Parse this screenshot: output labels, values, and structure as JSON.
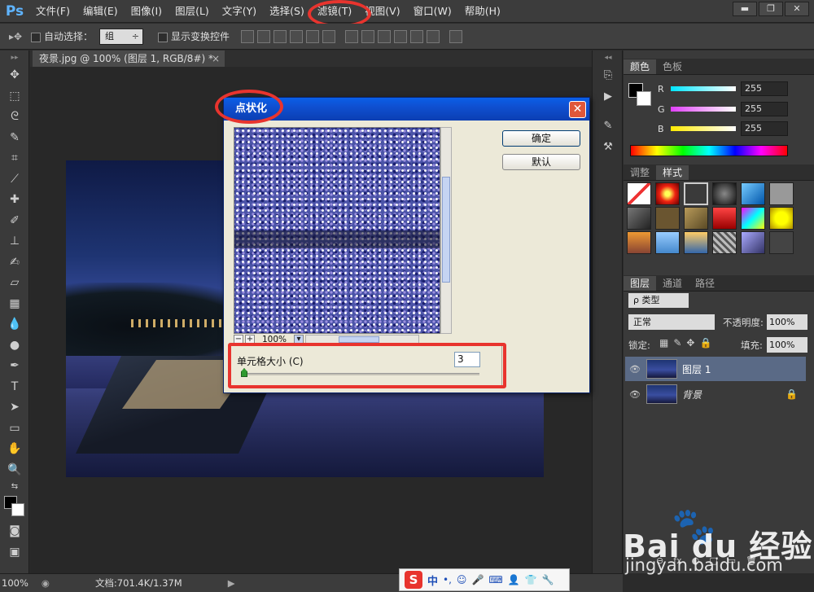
{
  "app": {
    "logo": "Ps"
  },
  "menu": [
    "文件(F)",
    "编辑(E)",
    "图像(I)",
    "图层(L)",
    "文字(Y)",
    "选择(S)",
    "滤镜(T)",
    "视图(V)",
    "窗口(W)",
    "帮助(H)"
  ],
  "window_buttons": [
    "▬",
    "❐",
    "✕"
  ],
  "options": {
    "auto_select_label": "自动选择：",
    "auto_select_value": "组",
    "show_transform_label": "显示变换控件"
  },
  "document": {
    "tab_title": "夜景.jpg @ 100% (图层 1, RGB/8#) *",
    "close_glyph": "×"
  },
  "dialog": {
    "title": "点状化",
    "close_glyph": "✕",
    "ok_label": "确定",
    "default_label": "默认",
    "zoom_level": "100%",
    "zoom_minus": "−",
    "zoom_plus": "+",
    "param_label": "单元格大小 (C)",
    "cell_size_value": "3"
  },
  "color_panel": {
    "tabs": [
      "颜色",
      "色板"
    ],
    "channels": [
      {
        "label": "R",
        "value": "255",
        "color": "#00e5ff"
      },
      {
        "label": "G",
        "value": "255",
        "color": "#e040fb"
      },
      {
        "label": "B",
        "value": "255",
        "color": "#ffea00"
      }
    ]
  },
  "styles_panel": {
    "tabs": [
      "调整",
      "样式"
    ]
  },
  "layers_panel": {
    "tabs": [
      "图层",
      "通道",
      "路径"
    ],
    "filter_label": "ρ 类型",
    "blend_mode": "正常",
    "opacity_label": "不透明度:",
    "opacity_value": "100%",
    "lock_label": "锁定:",
    "fill_label": "填充:",
    "fill_value": "100%",
    "layers": [
      {
        "name": "图层 1",
        "selected": true
      },
      {
        "name": "背景",
        "selected": false,
        "locked": true
      }
    ],
    "footer_icons": [
      "⊖",
      "fx",
      "◐",
      "▢",
      "▭",
      "🗑"
    ]
  },
  "status": {
    "zoom": "100%",
    "doc_info": "文档:701.4K/1.37M"
  },
  "ime": {
    "logo": "S",
    "lang": "中",
    "punct": "•,",
    "icons": [
      "☺",
      "🎤",
      "⌨",
      "👤",
      "👕",
      "🔧"
    ]
  },
  "watermark": {
    "brand": "Bai du 经验",
    "url": "jingyan.baidu.com"
  }
}
